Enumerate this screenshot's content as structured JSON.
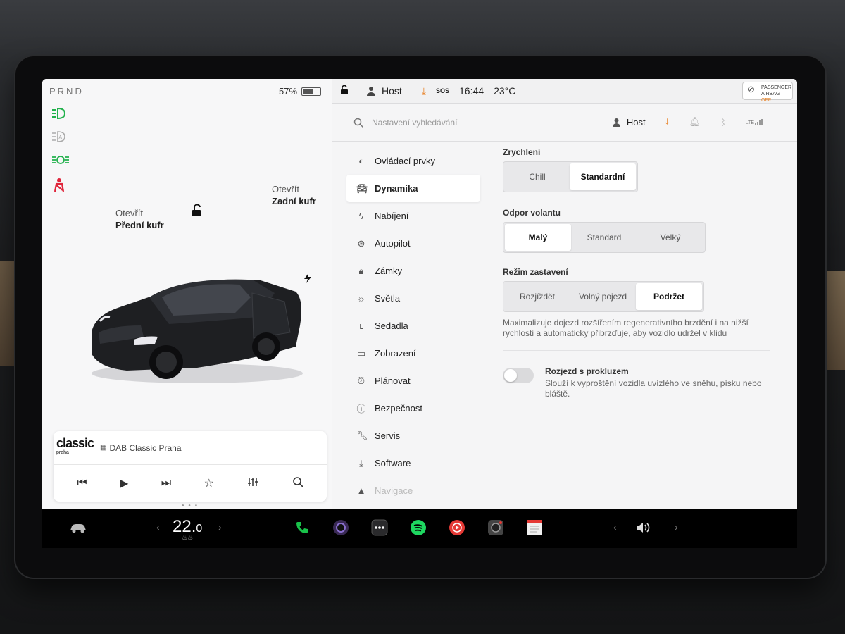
{
  "status": {
    "gear": "PRND",
    "battery_pct": "57%",
    "battery_level": 0.57
  },
  "left": {
    "front_trunk": {
      "status": "Otevřít",
      "name": "Přední kufr"
    },
    "rear_trunk": {
      "status": "Otevřít",
      "name": "Zadní kufr"
    },
    "telltales": [
      "headlight-on-icon",
      "auto-highbeam-icon",
      "parking-lights-icon",
      "seatbelt-warning-icon"
    ],
    "colors": {
      "telltale_green": "#22b14c",
      "telltale_red": "#e0243a"
    }
  },
  "media": {
    "logo_text": "classic",
    "logo_sub": "praha",
    "station": "DAB Classic Praha",
    "controls": [
      "prev-icon",
      "play-icon",
      "next-icon",
      "favorite-icon",
      "equalizer-icon",
      "search-icon"
    ]
  },
  "topbar": {
    "user": "Host",
    "sos": "SOS",
    "time": "16:44",
    "temp": "23°C",
    "airbag_line1": "PASSENGER",
    "airbag_line2": "AIRBAG",
    "airbag_state": "OFF"
  },
  "settings": {
    "search_placeholder": "Nastavení vyhledávání",
    "user": "Host",
    "lte": "LTE",
    "menu": [
      {
        "label": "Ovládací prvky",
        "icon": "toggle-icon"
      },
      {
        "label": "Dynamika",
        "icon": "car-icon",
        "active": true
      },
      {
        "label": "Nabíjení",
        "icon": "bolt-icon"
      },
      {
        "label": "Autopilot",
        "icon": "steering-wheel-icon"
      },
      {
        "label": "Zámky",
        "icon": "lock-icon"
      },
      {
        "label": "Světla",
        "icon": "sun-icon"
      },
      {
        "label": "Sedadla",
        "icon": "seat-icon"
      },
      {
        "label": "Zobrazení",
        "icon": "display-icon"
      },
      {
        "label": "Plánovat",
        "icon": "alarm-clock-icon"
      },
      {
        "label": "Bezpečnost",
        "icon": "info-circle-icon"
      },
      {
        "label": "Servis",
        "icon": "wrench-icon"
      },
      {
        "label": "Software",
        "icon": "download-icon"
      },
      {
        "label": "Navigace",
        "icon": "navigation-icon"
      }
    ],
    "acceleration": {
      "label": "Zrychlení",
      "options": [
        "Chill",
        "Standardní"
      ],
      "selected": "Standardní"
    },
    "steering": {
      "label": "Odpor volantu",
      "options": [
        "Malý",
        "Standard",
        "Velký"
      ],
      "selected": "Malý"
    },
    "stopping": {
      "label": "Režim zastavení",
      "options": [
        "Rozjíždět",
        "Volný pojezd",
        "Podržet"
      ],
      "selected": "Podržet",
      "description": "Maximalizuje dojezd rozšířením regenerativního brzdění i na nižší rychlosti a automaticky přibrzďuje, aby vozidlo udržel v klidu"
    },
    "slip_start": {
      "label": "Rozjezd s prokluzem",
      "description": "Slouží k vyproštění vozidla uvízlého ve sněhu, písku nebo bláště.",
      "enabled": false
    }
  },
  "dock": {
    "temp_int": "22.",
    "temp_dec": "0",
    "apps": [
      "car-icon",
      "phone-icon",
      "camera-icon",
      "more-icon",
      "spotify-icon",
      "youtube-music-icon",
      "dashcam-icon",
      "calendar-icon"
    ],
    "volume_icon": "volume-icon",
    "colors": {
      "phone": "#19c24a",
      "spotify": "#1ed760",
      "youtube": "#e53935"
    }
  }
}
